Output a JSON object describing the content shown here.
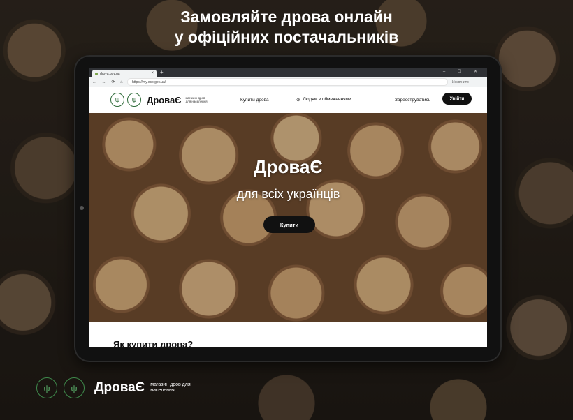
{
  "headline": {
    "line1": "Замовляйте дрова онлайн",
    "line2": "у офіційних постачальників"
  },
  "browser": {
    "tab_title": "drova.gov.ua",
    "url": "https://my.eco.gov.ua/",
    "profile": "Инкогнито"
  },
  "site": {
    "brand": "ДроваЄ",
    "tagline": "магазин дров для населення",
    "nav": {
      "buy": "Купити дрова",
      "accessibility": "Людям з обмеженнями",
      "register": "Зареєструватись",
      "login": "Увійти"
    },
    "hero": {
      "title": "ДроваЄ",
      "subtitle": "для всіх українців",
      "button": "Купити"
    },
    "section_title": "Як купити дрова?"
  },
  "footer": {
    "brand": "ДроваЄ",
    "tagline": "магазин дров для населення"
  },
  "colors": {
    "accent_green": "#3f8a4c",
    "button_black": "#111111"
  }
}
